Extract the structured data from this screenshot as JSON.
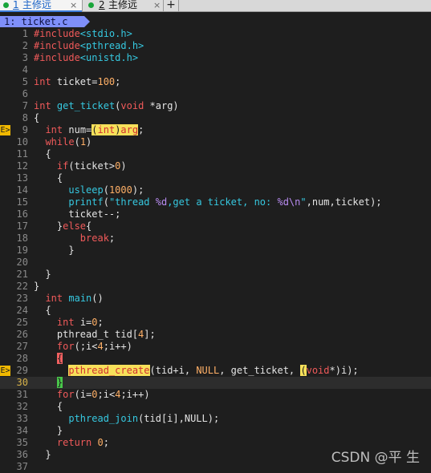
{
  "tabs": [
    {
      "num": "1",
      "name": "主修远",
      "close": "×",
      "active": true
    },
    {
      "num": "2",
      "name": "主修远",
      "close": "×",
      "active": false
    }
  ],
  "add_tab": "+",
  "buffer_label": "1: ticket.c",
  "sign_label": "E>",
  "code_lines": [
    {
      "n": "1",
      "text": "#include<stdio.h>"
    },
    {
      "n": "2",
      "text": "#include<pthread.h>"
    },
    {
      "n": "3",
      "text": "#include<unistd.h>"
    },
    {
      "n": "4",
      "text": ""
    },
    {
      "n": "5",
      "text": "int ticket=100;"
    },
    {
      "n": "6",
      "text": ""
    },
    {
      "n": "7",
      "text": "int get_ticket(void *arg)"
    },
    {
      "n": "8",
      "text": "{"
    },
    {
      "n": "9",
      "text": "  int num=(int)arg;"
    },
    {
      "n": "10",
      "text": "  while(1)"
    },
    {
      "n": "11",
      "text": "  {"
    },
    {
      "n": "12",
      "text": "    if(ticket>0)"
    },
    {
      "n": "13",
      "text": "    {"
    },
    {
      "n": "14",
      "text": "      usleep(1000);"
    },
    {
      "n": "15",
      "text": "      printf(\"thread %d,get a ticket, no: %d\\n\",num,ticket);"
    },
    {
      "n": "16",
      "text": "      ticket--;"
    },
    {
      "n": "17",
      "text": "    }else{"
    },
    {
      "n": "18",
      "text": "        break;"
    },
    {
      "n": "19",
      "text": "      }"
    },
    {
      "n": "20",
      "text": ""
    },
    {
      "n": "21",
      "text": "  }"
    },
    {
      "n": "22",
      "text": "}"
    },
    {
      "n": "23",
      "text": "  int main()"
    },
    {
      "n": "24",
      "text": "  {"
    },
    {
      "n": "25",
      "text": "    int i=0;"
    },
    {
      "n": "26",
      "text": "    pthread_t tid[4];"
    },
    {
      "n": "27",
      "text": "    for(;i<4;i++)"
    },
    {
      "n": "28",
      "text": "    {"
    },
    {
      "n": "29",
      "text": "      pthread_create(tid+i, NULL, get_ticket, (void*)i);"
    },
    {
      "n": "30",
      "text": "    }"
    },
    {
      "n": "31",
      "text": "    for(i=0;i<4;i++)"
    },
    {
      "n": "32",
      "text": "    {"
    },
    {
      "n": "33",
      "text": "      pthread_join(tid[i],NULL);"
    },
    {
      "n": "34",
      "text": "    }"
    },
    {
      "n": "35",
      "text": "    return 0;"
    },
    {
      "n": "36",
      "text": "  }"
    },
    {
      "n": "37",
      "text": ""
    }
  ],
  "error_lines": [
    "9",
    "29"
  ],
  "current_line": "30",
  "watermark": "CSDN @平 生",
  "colors": {
    "background": "#1e1e1e",
    "keyword": "#f05a5a",
    "function": "#36c8e0",
    "number": "#ffb067",
    "error_sign": "#f0b800",
    "buffer_tab": "#7f8ffa",
    "highlight": "#f7e05a"
  }
}
